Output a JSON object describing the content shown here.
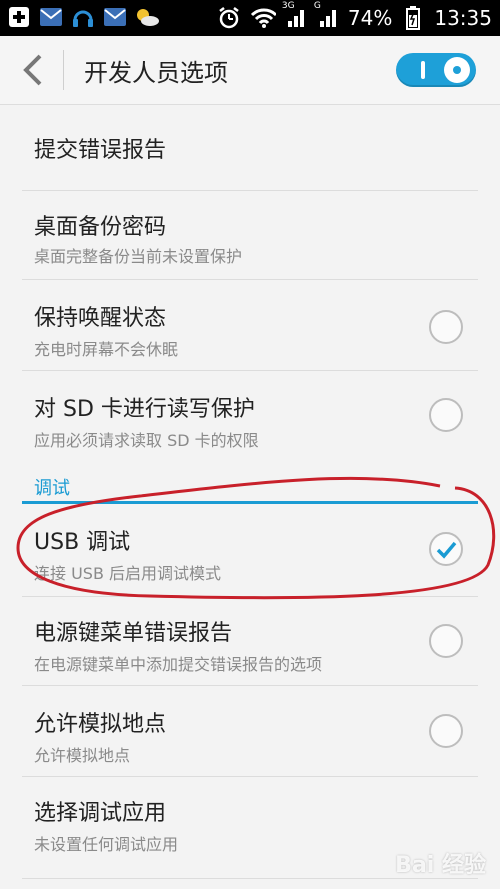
{
  "status_bar": {
    "icons_left": [
      "plus-icon",
      "mail-icon",
      "headset-icon",
      "mail-icon",
      "weather-icon"
    ],
    "icons_right": [
      "alarm-icon",
      "wifi-icon",
      "signal-icon",
      "battery-icon"
    ],
    "signal1_label": "3G",
    "signal2_label": "G",
    "battery": "74%",
    "time": "13:35"
  },
  "action_bar": {
    "title": "开发人员选项",
    "toggle_on": true
  },
  "settings": [
    {
      "title": "提交错误报告",
      "summary": "",
      "checkbox": null
    },
    {
      "title": "桌面备份密码",
      "summary": "桌面完整备份当前未设置保护",
      "checkbox": null
    },
    {
      "title": "保持唤醒状态",
      "summary": "充电时屏幕不会休眠",
      "checkbox": false
    },
    {
      "title": "对 SD 卡进行读写保护",
      "summary": "应用必须请求读取 SD 卡的权限",
      "checkbox": false
    }
  ],
  "section_debug": "调试",
  "debug_settings": [
    {
      "title": "USB 调试",
      "summary": "连接 USB 后启用调试模式",
      "checkbox": true
    },
    {
      "title": "电源键菜单错误报告",
      "summary": "在电源键菜单中添加提交错误报告的选项",
      "checkbox": false
    },
    {
      "title": "允许模拟地点",
      "summary": "允许模拟地点",
      "checkbox": false
    },
    {
      "title": "选择调试应用",
      "summary": "未设置任何调试应用",
      "checkbox": null
    }
  ],
  "watermark": "Bai 经验",
  "colors": {
    "accent": "#1a9bd3",
    "annotation": "#c8202a"
  }
}
